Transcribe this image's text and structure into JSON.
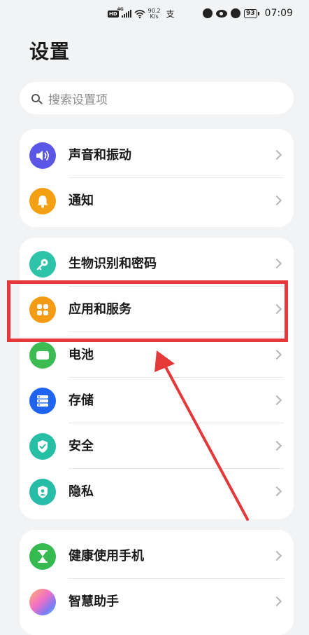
{
  "status_bar": {
    "hd": "HD",
    "network": "4G",
    "speed_value": "90.2",
    "speed_unit": "K/s",
    "pay_glyph": "支",
    "battery": "93",
    "time": "07:09"
  },
  "page_title": "设置",
  "search": {
    "placeholder": "搜索设置项"
  },
  "groups": [
    {
      "items": [
        {
          "label": "声音和振动",
          "icon": "speaker-icon",
          "color": "#5b57e6"
        },
        {
          "label": "通知",
          "icon": "bell-icon",
          "color": "#f4a014"
        }
      ]
    },
    {
      "items": [
        {
          "label": "生物识别和密码",
          "icon": "key-icon",
          "color": "#2cc3a8"
        },
        {
          "label": "应用和服务",
          "icon": "apps-grid-icon",
          "color": "#f49b15"
        },
        {
          "label": "电池",
          "icon": "battery-icon",
          "color": "#3dbb53"
        },
        {
          "label": "存储",
          "icon": "storage-icon",
          "color": "#1f64f0"
        },
        {
          "label": "安全",
          "icon": "shield-check-icon",
          "color": "#26bfa6"
        },
        {
          "label": "隐私",
          "icon": "privacy-shield-icon",
          "color": "#27bca8"
        }
      ]
    },
    {
      "items": [
        {
          "label": "健康使用手机",
          "icon": "hourglass-icon",
          "color": "#36b94f"
        },
        {
          "label": "智慧助手",
          "icon": "assistant-orb-icon",
          "color": "#c86ef0"
        }
      ]
    }
  ],
  "annotation": {
    "highlight_color": "#e53939"
  }
}
